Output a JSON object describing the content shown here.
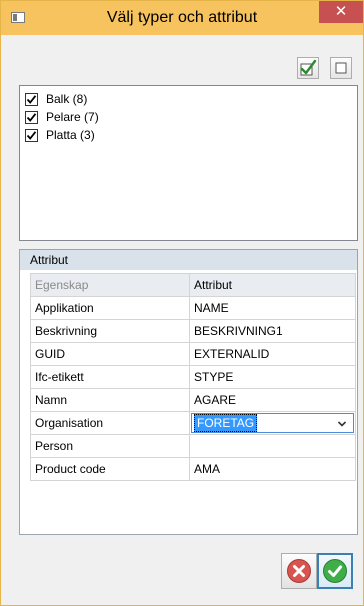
{
  "window": {
    "title": "Välj typer och attribut",
    "close_glyph": "✕"
  },
  "toolbar": {
    "check_all_icon": "checkmark-pen-icon",
    "uncheck_all_icon": "empty-box-icon"
  },
  "types": [
    {
      "label": "Balk (8)",
      "checked": true
    },
    {
      "label": "Pelare (7)",
      "checked": true
    },
    {
      "label": "Platta (3)",
      "checked": true
    }
  ],
  "attributes": {
    "section_title": "Attribut",
    "columns": [
      "Egenskap",
      "Attribut"
    ],
    "rows": [
      {
        "property": "Applikation",
        "attribute": "NAME"
      },
      {
        "property": "Beskrivning",
        "attribute": "BESKRIVNING1"
      },
      {
        "property": "GUID",
        "attribute": "EXTERNALID"
      },
      {
        "property": "Ifc-etikett",
        "attribute": "STYPE"
      },
      {
        "property": "Namn",
        "attribute": "AGARE"
      },
      {
        "property": "Organisation",
        "attribute": "FORETAG",
        "editing": true
      },
      {
        "property": "Person",
        "attribute": ""
      },
      {
        "property": "Product code",
        "attribute": "AMA"
      }
    ]
  },
  "buttons": {
    "cancel_icon": "red-x-circle-icon",
    "ok_icon": "green-check-circle-icon"
  },
  "colors": {
    "titlebar": "#f7c35f",
    "close_button": "#c75050",
    "header_band": "#d9e1ea",
    "selection": "#3399ff",
    "cancel_red": "#d9534f",
    "ok_green": "#3fae49"
  }
}
